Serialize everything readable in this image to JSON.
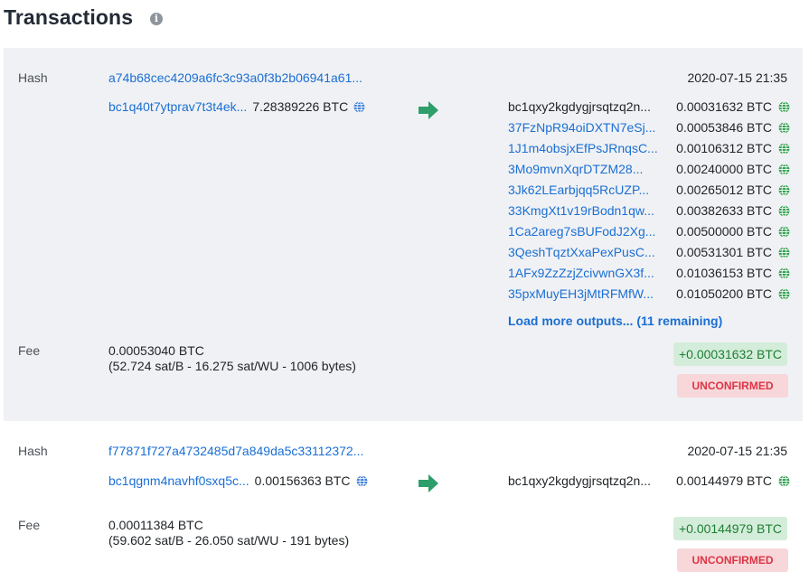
{
  "page": {
    "title": "Transactions",
    "info_icon": "info-icon"
  },
  "labels": {
    "hash": "Hash",
    "fee": "Fee"
  },
  "colors": {
    "link": "#1a6fd4",
    "arrow": "#2e9e6a",
    "globe": "#2f9e4f",
    "globe_blue": "#3b7dd8",
    "confirmed_bg": "#d4edda",
    "unconfirmed_bg": "#f8d7da"
  },
  "transactions": [
    {
      "hash": "a74b68cec4209a6fc3c93a0f3b2b06941a61...",
      "date": "2020-07-15 21:35",
      "input": {
        "address": "bc1q40t7ytprav7t3t4ek...",
        "amount": "7.28389226 BTC",
        "icon": "globe-icon"
      },
      "outputs": [
        {
          "address": "bc1qxy2kgdygjrsqtzq2n...",
          "amount": "0.00031632 BTC",
          "is_link": false
        },
        {
          "address": "37FzNpR94oiDXTN7eSj...",
          "amount": "0.00053846 BTC",
          "is_link": true
        },
        {
          "address": "1J1m4obsjxEfPsJRnqsC...",
          "amount": "0.00106312 BTC",
          "is_link": true
        },
        {
          "address": "3Mo9mvnXqrDTZM28...",
          "amount": "0.00240000 BTC",
          "is_link": true
        },
        {
          "address": "3Jk62LEarbjqq5RcUZP...",
          "amount": "0.00265012 BTC",
          "is_link": true
        },
        {
          "address": "33KmgXt1v19rBodn1qw...",
          "amount": "0.00382633 BTC",
          "is_link": true
        },
        {
          "address": "1Ca2areg7sBUFodJ2Xg...",
          "amount": "0.00500000 BTC",
          "is_link": true
        },
        {
          "address": "3QeshTqztXxaPexPusC...",
          "amount": "0.00531301 BTC",
          "is_link": true
        },
        {
          "address": "1AFx9ZzZzjZcivwnGX3f...",
          "amount": "0.01036153 BTC",
          "is_link": true
        },
        {
          "address": "35pxMuyEH3jMtRFMfW...",
          "amount": "0.01050200 BTC",
          "is_link": true
        }
      ],
      "load_more": "Load more outputs... (11 remaining)",
      "fee": {
        "amount": "0.00053040 BTC",
        "detail": "(52.724 sat/B - 16.275 sat/WU - 1006 bytes)"
      },
      "net_amount": "+0.00031632 BTC",
      "status": "UNCONFIRMED"
    },
    {
      "hash": "f77871f727a4732485d7a849da5c33112372...",
      "date": "2020-07-15 21:35",
      "input": {
        "address": "bc1qgnm4navhf0sxq5c...",
        "amount": "0.00156363 BTC",
        "icon": "globe-icon"
      },
      "outputs": [
        {
          "address": "bc1qxy2kgdygjrsqtzq2n...",
          "amount": "0.00144979 BTC",
          "is_link": false
        }
      ],
      "fee": {
        "amount": "0.00011384 BTC",
        "detail": "(59.602 sat/B - 26.050 sat/WU - 191 bytes)"
      },
      "net_amount": "+0.00144979 BTC",
      "status": "UNCONFIRMED"
    }
  ]
}
